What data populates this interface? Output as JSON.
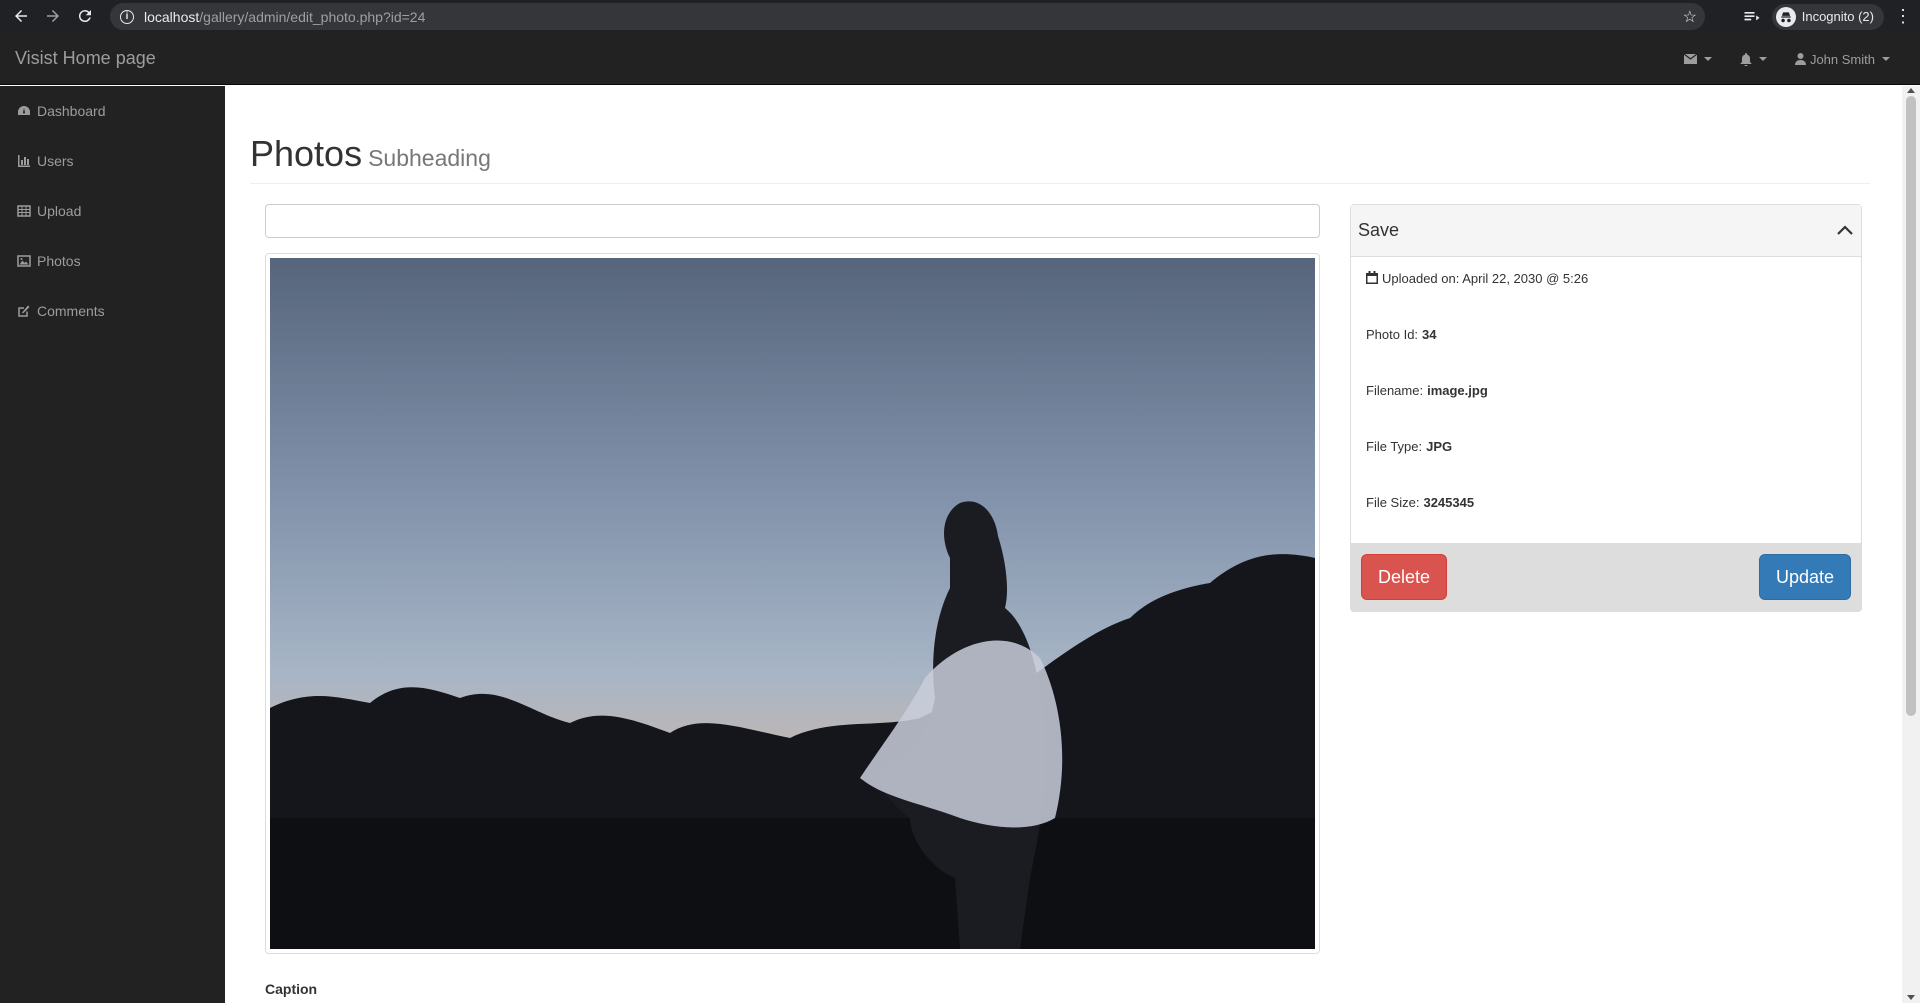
{
  "browser": {
    "url_host": "localhost",
    "url_path": "/gallery/admin/edit_photo.php?id=24",
    "incognito_label": "Incognito (2)"
  },
  "navbar": {
    "brand": "Visist Home page",
    "user_name": "John Smith",
    "icons": [
      "envelope-icon",
      "bell-icon",
      "user-icon"
    ]
  },
  "sidebar": {
    "items": [
      {
        "label": "Dashboard",
        "icon": "dashboard-icon"
      },
      {
        "label": "Users",
        "icon": "bar-chart-icon"
      },
      {
        "label": "Upload",
        "icon": "table-icon"
      },
      {
        "label": "Photos",
        "icon": "picture-icon"
      },
      {
        "label": "Comments",
        "icon": "edit-icon"
      }
    ]
  },
  "page": {
    "title": "Photos",
    "subtitle": "Subheading",
    "title_input_value": "",
    "caption_label": "Caption"
  },
  "save_panel": {
    "title": "Save",
    "uploaded_label": "Uploaded on: April 22, 2030 @ 5:26",
    "photo_id_label": "Photo Id:",
    "photo_id": "34",
    "filename_label": "Filename:",
    "filename": "image.jpg",
    "filetype_label": "File Type:",
    "filetype": "JPG",
    "filesize_label": "File Size:",
    "filesize": "3245345",
    "delete_label": "Delete",
    "update_label": "Update"
  },
  "colors": {
    "navbar_bg": "#222222",
    "danger": "#d9534f",
    "primary": "#337ab7",
    "panel_footer": "#dddddd"
  }
}
